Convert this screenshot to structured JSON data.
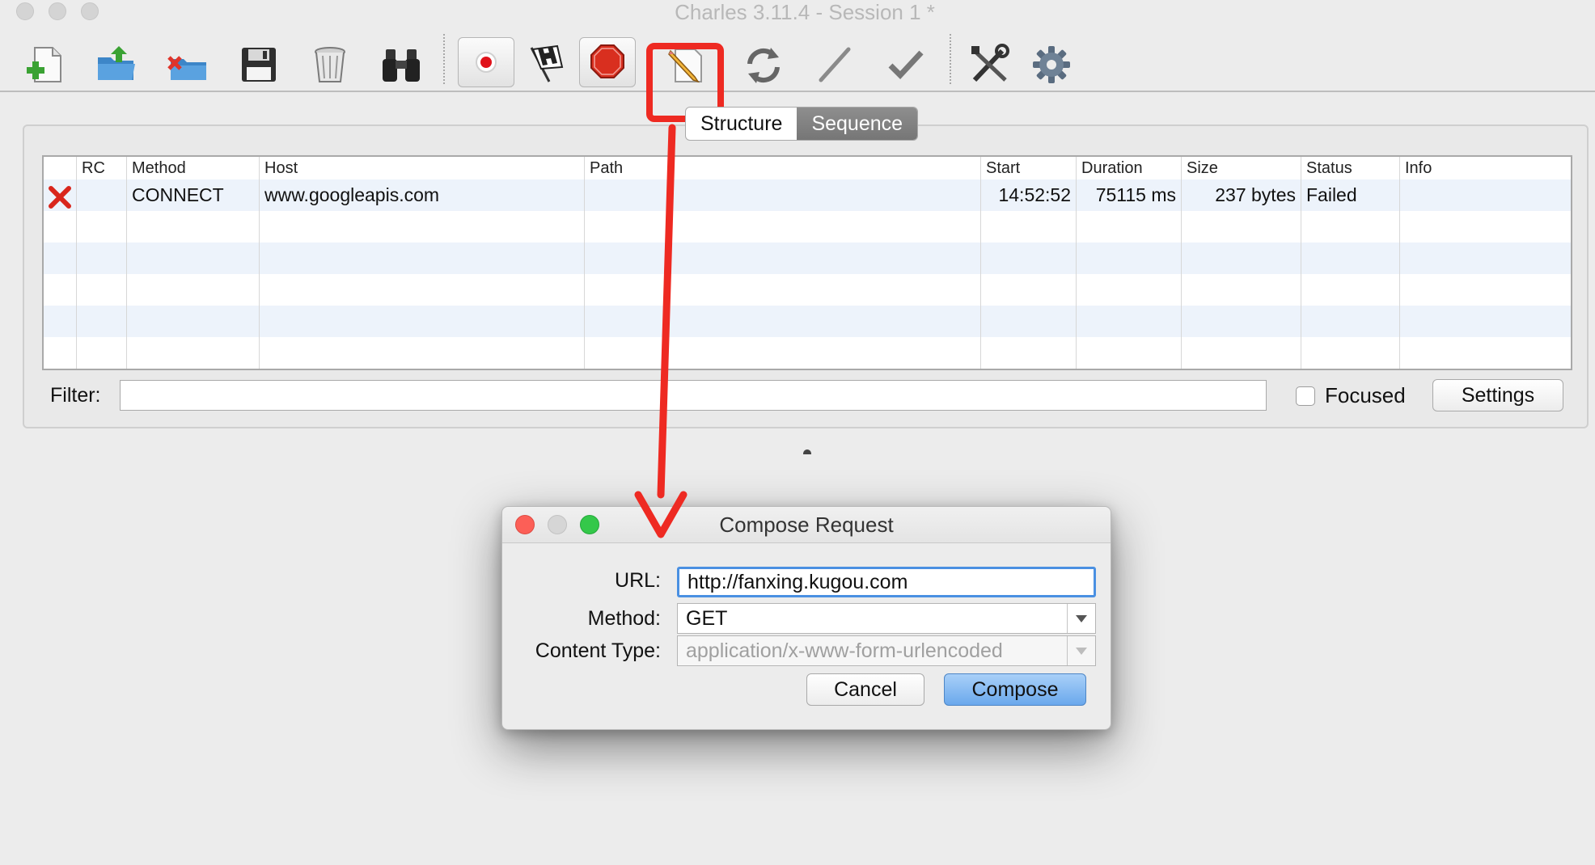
{
  "window": {
    "title": "Charles 3.11.4 - Session 1 *"
  },
  "toolbar": {
    "items": [
      {
        "name": "new-session",
        "icon": "new-session-icon"
      },
      {
        "name": "open-session",
        "icon": "folder-open-icon"
      },
      {
        "name": "close-session",
        "icon": "folder-close-icon"
      },
      {
        "name": "save-session",
        "icon": "floppy-disk-icon"
      },
      {
        "name": "clear-session",
        "icon": "trash-icon"
      },
      {
        "name": "find",
        "icon": "binoculars-icon"
      },
      {
        "name": "start-recording",
        "icon": "record-icon"
      },
      {
        "name": "throttling",
        "icon": "checkered-flag-icon"
      },
      {
        "name": "breakpoints",
        "icon": "stop-sign-icon"
      },
      {
        "name": "compose",
        "icon": "pencil-icon"
      },
      {
        "name": "repeat",
        "icon": "refresh-icon"
      },
      {
        "name": "edit",
        "icon": "slash-pen-icon"
      },
      {
        "name": "validate",
        "icon": "checkmark-icon"
      },
      {
        "name": "tools",
        "icon": "tools-icon"
      },
      {
        "name": "settings",
        "icon": "gear-icon"
      }
    ]
  },
  "view_tabs": [
    "Structure",
    "Sequence"
  ],
  "view_tabs_active": "Sequence",
  "table": {
    "columns": [
      "",
      "RC",
      "Method",
      "Host",
      "Path",
      "Start",
      "Duration",
      "Size",
      "Status",
      "Info"
    ],
    "rows": [
      {
        "status_icon": "failed-x-icon",
        "rc": "",
        "method": "CONNECT",
        "host": "www.googleapis.com",
        "path": "",
        "start": "14:52:52",
        "duration": "75115 ms",
        "size": "237 bytes",
        "status": "Failed",
        "info": ""
      }
    ]
  },
  "filter": {
    "label": "Filter:",
    "value": "",
    "focused_label": "Focused",
    "focused_checked": false,
    "settings_label": "Settings"
  },
  "dialog": {
    "title": "Compose Request",
    "url_label": "URL:",
    "url_value": "http://fanxing.kugou.com",
    "method_label": "Method:",
    "method_value": "GET",
    "content_type_label": "Content Type:",
    "content_type_value": "application/x-www-form-urlencoded",
    "cancel_label": "Cancel",
    "compose_label": "Compose"
  },
  "colors": {
    "annotation": "#ee2a22",
    "focus_ring": "#4a90e2",
    "primary_button": "#7fb4ee"
  }
}
